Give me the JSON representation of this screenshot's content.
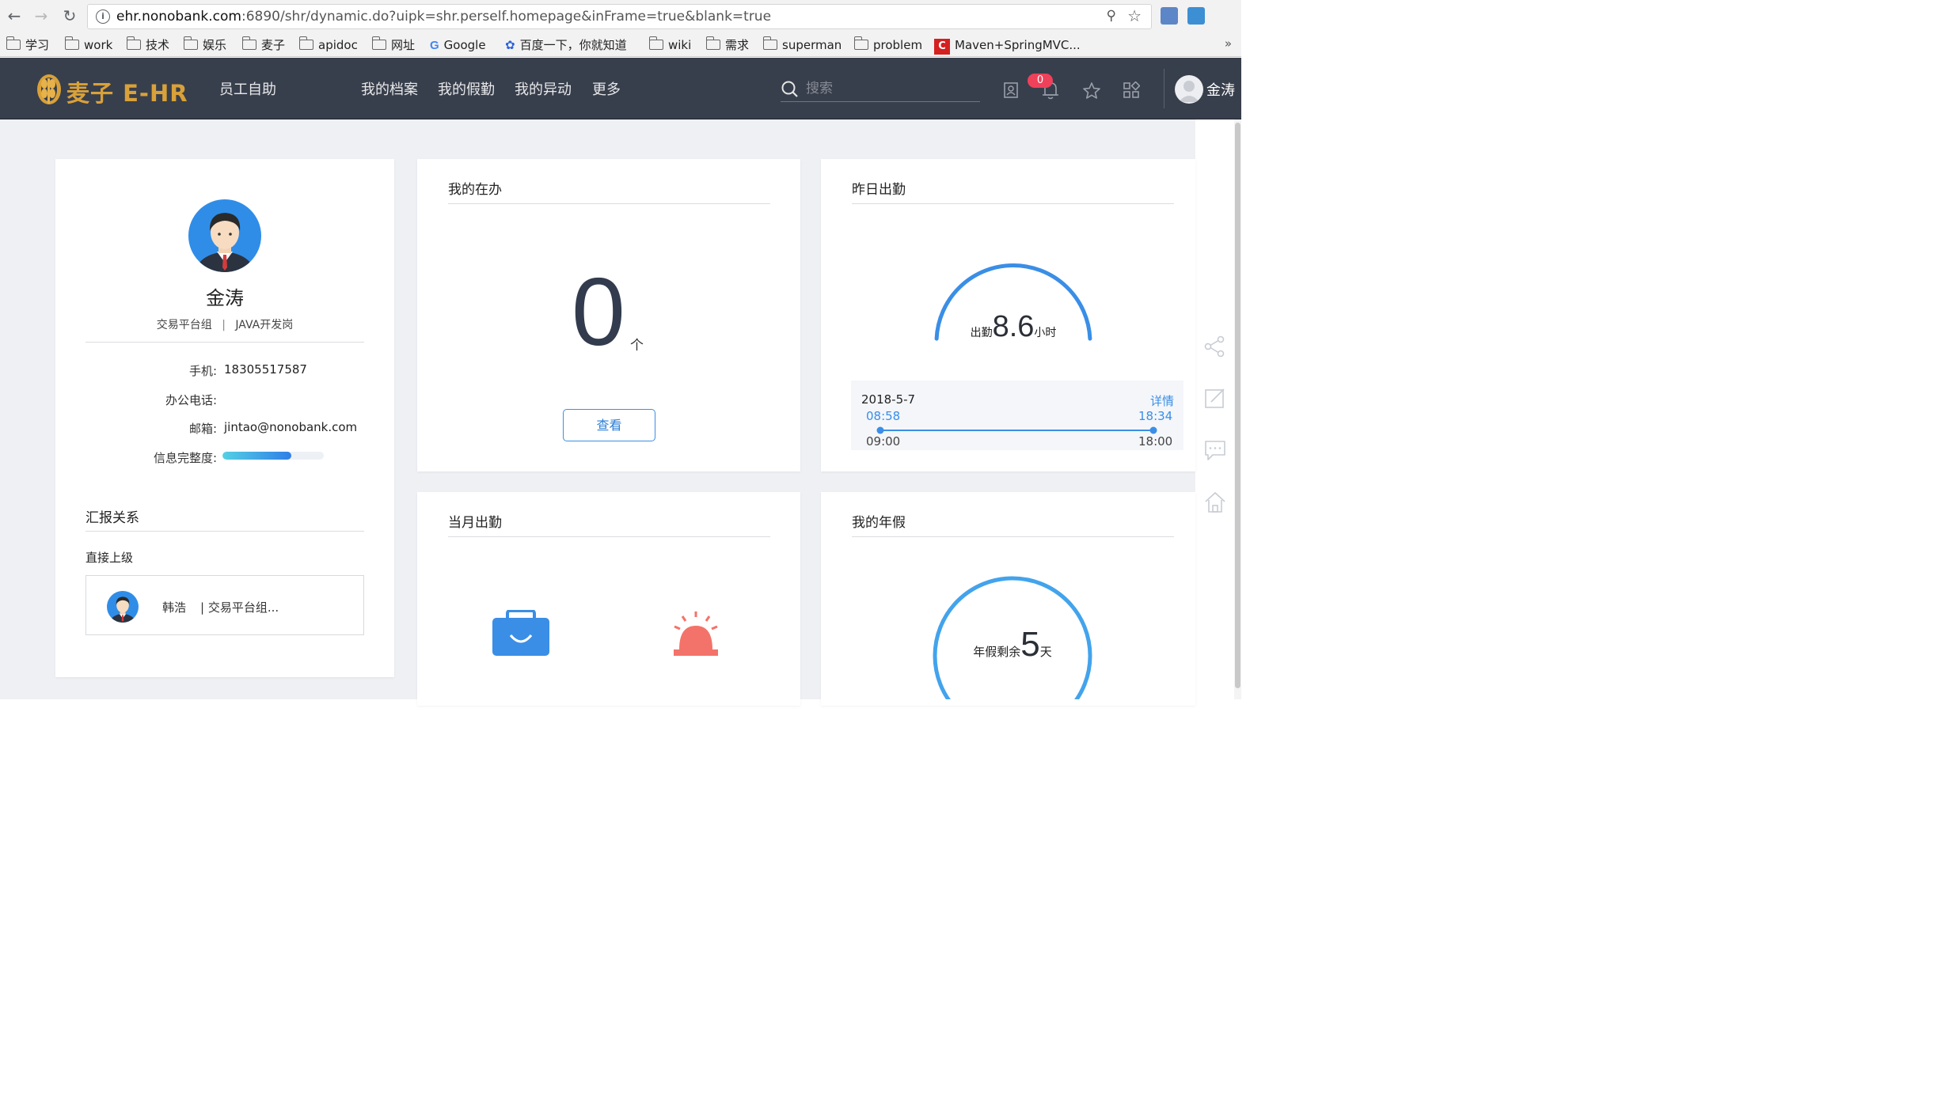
{
  "browser": {
    "url_host": "ehr.nonobank.com",
    "url_rest": ":6890/shr/dynamic.do?uipk=shr.perself.homepage&inFrame=true&blank=true",
    "bookmarks": [
      "学习",
      "work",
      "技术",
      "娱乐",
      "麦子",
      "apidoc",
      "网址",
      "Google",
      "百度一下，你就知道",
      "wiki",
      "需求",
      "superman",
      "problem",
      "Maven+SpringMVC..."
    ],
    "overflow": "»"
  },
  "header": {
    "logo_text": "麦子 E-HR",
    "nav_items": [
      "员工自助",
      "我的档案",
      "我的假勤",
      "我的异动",
      "更多"
    ],
    "search_placeholder": "搜索",
    "notification_count": "0",
    "user_name": "金涛"
  },
  "profile": {
    "name": "金涛",
    "department": "交易平台组",
    "separator": "|",
    "position": "JAVA开发岗",
    "phone_label": "手机:",
    "phone": "18305517587",
    "office_phone_label": "办公电话:",
    "office_phone": "",
    "email_label": "邮箱:",
    "email": "jintao@nonobank.com",
    "completeness_label": "信息完整度:",
    "completeness": 0.68,
    "reporting_title": "汇报关系",
    "direct_superior_label": "直接上级",
    "superior_name": "韩浩",
    "superior_department": "| 交易平台组..."
  },
  "todo": {
    "title": "我的在办",
    "count": "0",
    "unit": "个",
    "view_button": "查看"
  },
  "yesterday_attendance": {
    "title": "昨日出勤",
    "label": "出勤",
    "hours": "8.6",
    "unit": "小时",
    "gauge_fraction": 0.86,
    "date": "2018-5-7",
    "detail_link": "详情",
    "clock_in": "08:58",
    "clock_out": "18:34",
    "shift_start": "09:00",
    "shift_end": "18:00"
  },
  "month_attendance": {
    "title": "当月出勤"
  },
  "annual_leave": {
    "title": "我的年假",
    "label": "年假剩余",
    "days": "5",
    "unit": "天"
  },
  "colors": {
    "header_bg": "#383f4c",
    "page_bg": "#eef0f4",
    "accent_blue": "#3a8ee6",
    "logo_gold": "#d9a13a",
    "badge_red": "#f0415a",
    "alarm_red": "#f3736a"
  }
}
